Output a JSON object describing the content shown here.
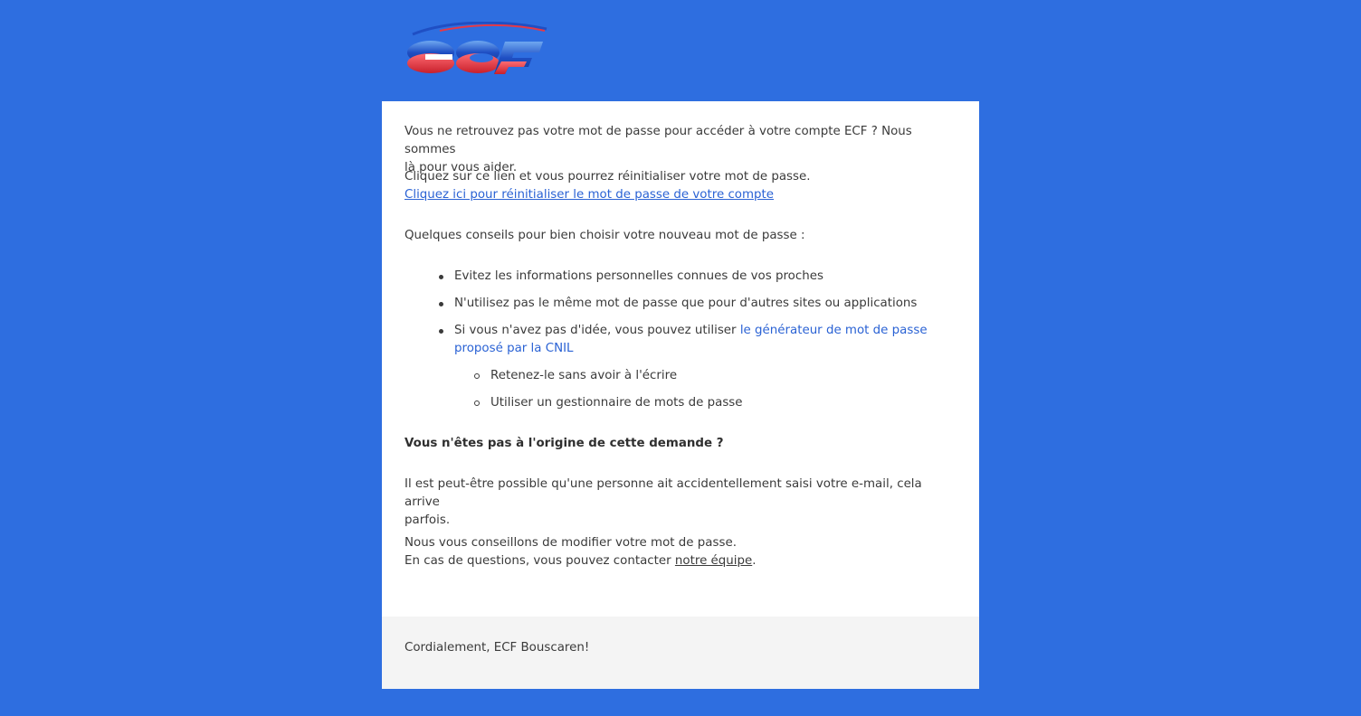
{
  "logo": {
    "text": "ECF",
    "colors": {
      "blue": "#1f4fc4",
      "red": "#e63946",
      "light_blue": "#7fb2f0"
    }
  },
  "colors": {
    "background": "#2e6ee0",
    "card": "#ffffff",
    "footer": "#f4f4f4",
    "link": "#2a62d4",
    "text": "#3a3a3a"
  },
  "intro": {
    "line1": "Vous ne retrouvez pas votre mot de passe pour accéder à votre compte ECF ? Nous sommes",
    "line2": "là pour vous aider."
  },
  "reset": {
    "text": "Cliquez sur ce lien et vous pourrez réinitialiser votre mot de passe.",
    "link_label": "Cliquez ici pour réinitialiser le mot de passe de votre compte"
  },
  "tips": {
    "heading": "Quelques conseils pour bien choisir votre nouveau mot de passe :",
    "items": [
      "Evitez les informations personnelles connues de vos proches",
      "N'utilisez pas le même mot de passe que pour d'autres sites ou applications"
    ],
    "generator": {
      "prefix": "Si vous n'avez pas d'idée, vous pouvez utiliser ",
      "link_line1": "le générateur de mot de passe",
      "link_line2": "proposé par la CNIL"
    },
    "sub_items": [
      "Retenez-le sans avoir à l'écrire",
      "Utiliser un gestionnaire de mots de passe"
    ]
  },
  "not_you": {
    "heading": "Vous n'êtes pas à l'origine de cette demande ?",
    "line1": "Il est peut-être possible qu'une personne ait accidentellement saisi votre e-mail, cela arrive",
    "line2": "parfois."
  },
  "advice": {
    "line1": "Nous vous conseillons de modifier votre mot de passe.",
    "line2_prefix": "En cas de questions, vous pouvez contacter ",
    "team_link": "notre équipe",
    "line2_suffix": "."
  },
  "footer": {
    "signature": "Cordialement, ECF Bouscaren!"
  }
}
